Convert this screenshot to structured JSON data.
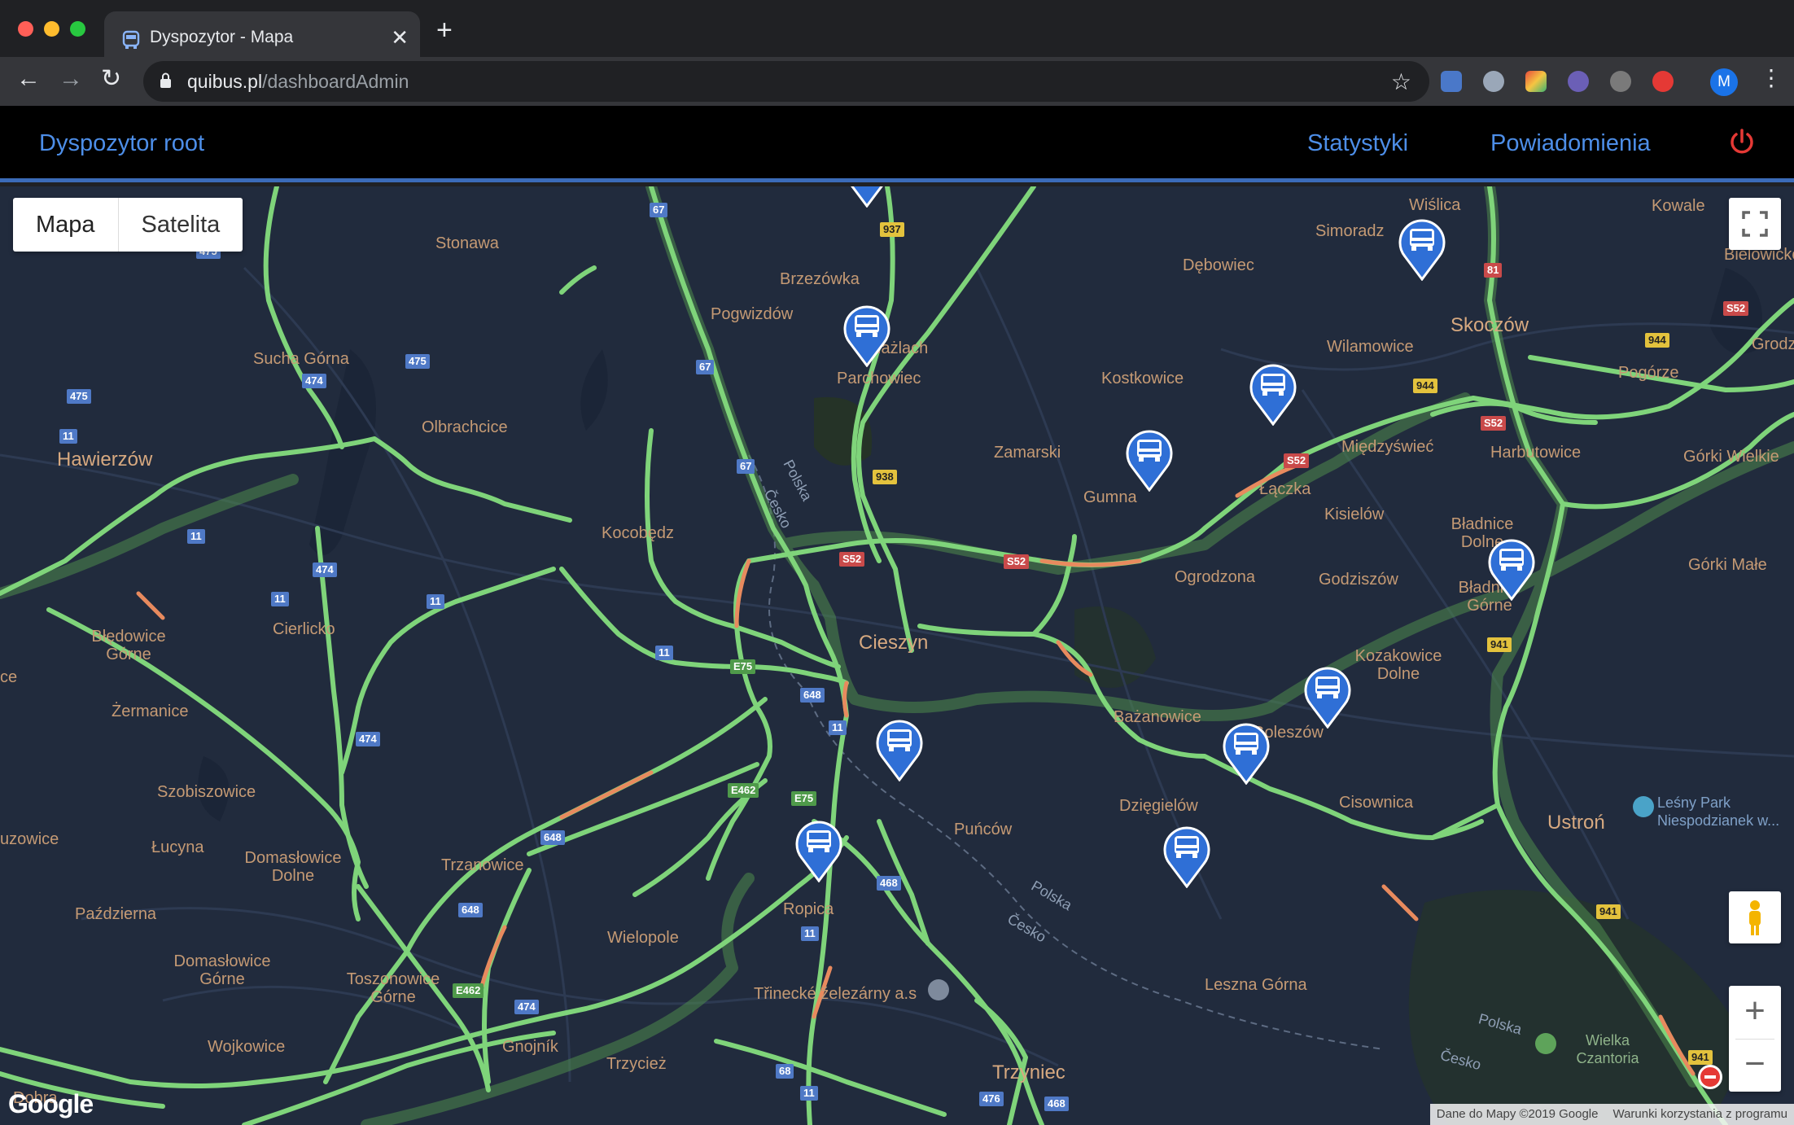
{
  "browser": {
    "tab_title": "Dyspozytor - Mapa",
    "url_domain": "quibus.pl",
    "url_path": "/dashboardAdmin",
    "profile_initial": "M"
  },
  "header": {
    "brand": "Dyspozytor root",
    "nav": [
      "Statystyki",
      "Powiadomienia"
    ]
  },
  "map": {
    "type_buttons": [
      "Mapa",
      "Satelita"
    ],
    "places": [
      "Stonawa",
      "Brzezówka",
      "Pogwizdów",
      "Hażlach",
      "Parchowiec",
      "Sucha Górna",
      "Olbrachcice",
      "Hawierzów",
      "Kocobędz",
      "Cieszyn",
      "Zamarski",
      "Gumna",
      "Kostkowice",
      "Dębowiec",
      "Simoradz",
      "Wiślica",
      "Kowale",
      "Bielowicko",
      "Skoczów",
      "Wilamowice",
      "Pogórze",
      "Grodz",
      "Międzyświeć",
      "Harbutowice",
      "Górki Wielkie",
      "Łączka",
      "Kisielów",
      "Bładnice Dolne",
      "Bładnice Górne",
      "Górki Małe",
      "Ogrodzona",
      "Godziszów",
      "Kozakowice Dolne",
      "Bażanowice",
      "Goleszów",
      "Cisownica",
      "Ustroń",
      "Leśny Park Niespodzianek w...",
      "Dzięgielów",
      "Puńców",
      "Ropica",
      "Wielopole",
      "Trzanowice",
      "Błędowice Górne",
      "Cierlicko",
      "Żermanice",
      "Szobiszowice",
      "Łucyna",
      "Domasłowice Dolne",
      "Domasłowice Górne",
      "Październa",
      "Toszonowice Górne",
      "Wojkowice",
      "Gnojník",
      "Trzycież",
      "Trzyniec",
      "Třinecké železárny a.s",
      "Leszna Górna",
      "Wielka Czantoria",
      "uzowice",
      "Dobra",
      "ce"
    ],
    "border_labels": [
      "Polska",
      "Česko"
    ],
    "shields": [
      "67",
      "475",
      "474",
      "11",
      "937",
      "938",
      "S52",
      "944",
      "81",
      "941",
      "E75",
      "E462",
      "648",
      "468",
      "476",
      "68"
    ],
    "bus_pin_count": 10,
    "google_logo": "Google",
    "attribution": [
      "Dane do Mapy ©2019 Google",
      "Warunki korzystania z programu"
    ]
  },
  "colors": {
    "map_background": "#212b3d",
    "road_traffic": "#7fd47a",
    "road_slow": "#e88a5e",
    "header_link": "#4d8ee8",
    "header_border": "#3b6bb8",
    "power_icon": "#e53935",
    "pin_blue": "#2f6fd6"
  }
}
